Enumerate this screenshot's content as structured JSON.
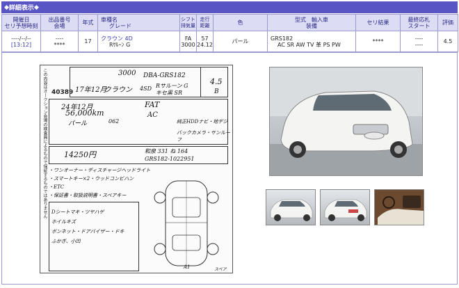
{
  "header": {
    "title": "詳細表示",
    "diamond": "◆"
  },
  "columns": [
    {
      "l1": "開催日",
      "l2": "セリ予想時刻"
    },
    {
      "l1": "出品番号",
      "l2": "会場"
    },
    {
      "l1": "年式",
      "l2": ""
    },
    {
      "l1": "車種名",
      "l2": "グレード"
    },
    {
      "l1": "シフト",
      "l2": "排気量"
    },
    {
      "l1": "走行",
      "l2": "距離"
    },
    {
      "l1": "色",
      "l2": ""
    },
    {
      "l1": "型式　輸入車",
      "l2": "装備"
    },
    {
      "l1": "セリ結果",
      "l2": ""
    },
    {
      "l1": "最終応札",
      "l2": "スタート"
    },
    {
      "l1": "評価",
      "l2": ""
    }
  ],
  "row": {
    "date": "----/--/--",
    "time": "[13:12]",
    "lot_no": "----",
    "venue": "****",
    "year": "17",
    "model": "クラウン 4D",
    "grade": "Rｻﾙｰﾝ G",
    "shift": "FA",
    "displacement": "3000",
    "mileage_1": "57",
    "mileage_2": "24.12",
    "color": "パール",
    "model_code": "GRS182",
    "equipment": "AC SR AW TV 革 PS PW",
    "result": "****",
    "final_bid": "----",
    "start": "----",
    "rating": "4.5"
  },
  "sheet": {
    "lot": "40389",
    "side_text": "この内容はオークション会場の検査員によるもので保証するものではありません",
    "hw_disp": "3000",
    "hw_type": "DBA-GRS182",
    "hw_model": "クラウン",
    "hw_year": "17年12月",
    "hw_grade": "Rサルーン G",
    "hw_grade2": "キセ黒 SR",
    "hw_doors": "4SD",
    "hw_rating": "4.5",
    "hw_interior": "B",
    "hw_shaken": "24年12月",
    "hw_mileage": "56,000km",
    "hw_color": "パール",
    "hw_color_code": "062",
    "hw_trans": "FAT",
    "hw_ac": "AC",
    "hw_price": "14250円",
    "hw_chassis": "GRS182-1022951",
    "hw_reg": "和泉 331 ね 164",
    "hw_notes1": "・ワンオーナー・ディスチャージヘッドライト",
    "hw_notes2": "・スマートキー×2・ウッドコンビハン",
    "hw_notes3": "・ETC",
    "hw_notes4": "・保証書・取扱説明書・スペアキー",
    "hw_eq1": "純正HDDナビ・地デジ",
    "hw_eq2": "バックカメラ・サンルーフ",
    "hw_insp1": "Dシートマキ・ツヤハゲ",
    "hw_insp2": "ホイルキズ",
    "hw_insp3": "ボンネット・ドアバイザー・ドキ",
    "hw_insp4": "ふかぎ、小凹",
    "diagram_a1": "A1",
    "diagram_spare": "スペア"
  },
  "icons": {
    "photo_main": "car-front-photo",
    "thumb1": "car-front-photo",
    "thumb2": "car-rear-photo",
    "thumb3": "interior-photo"
  },
  "colors": {
    "header_bg": "#5a55c4",
    "table_head_bg": "#dcdcf4",
    "border": "#9a9ad0"
  }
}
